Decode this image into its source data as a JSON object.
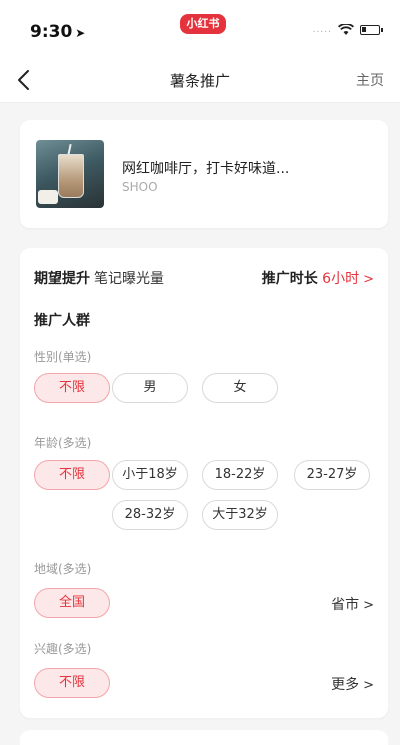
{
  "status_bar": {
    "time": "9:30",
    "app_badge": "小红书",
    "signal": "....."
  },
  "nav": {
    "title": "薯条推广",
    "home": "主页"
  },
  "note": {
    "title": "网红咖啡厅，打卡好味道...",
    "author": "SHOO"
  },
  "boost": {
    "goal_key": "期望提升",
    "goal_value": "笔记曝光量",
    "duration_key": "推广时长",
    "duration_value": "6小时"
  },
  "crowd": {
    "title": "推广人群",
    "gender": {
      "label": "性别(单选)",
      "options": [
        "不限",
        "男",
        "女"
      ],
      "selected": "不限"
    },
    "age": {
      "label": "年龄(多选)",
      "options": [
        "不限",
        "小于18岁",
        "18-22岁",
        "23-27岁",
        "28-32岁",
        "大于32岁"
      ],
      "selected": [
        "不限"
      ]
    },
    "region": {
      "label": "地域(多选)",
      "selected_chip": "全国",
      "link": "省市"
    },
    "interest": {
      "label": "兴趣(多选)",
      "selected_chip": "不限",
      "link": "更多"
    }
  },
  "colors": {
    "accent": "#e5333d",
    "chip_selected_bg": "#fde8e9",
    "page_bg": "#f5f5f6"
  }
}
